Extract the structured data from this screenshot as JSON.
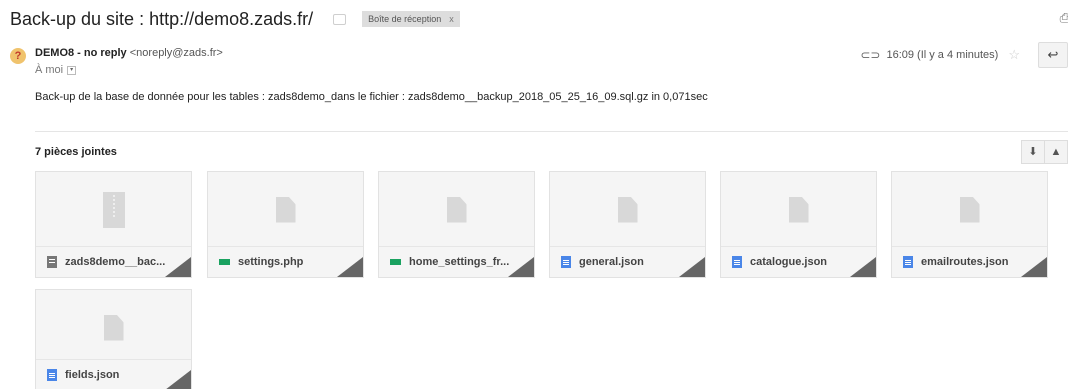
{
  "email": {
    "subject": "Back-up du site : http://demo8.zads.fr/",
    "label_chip": "Boîte de réception",
    "label_remove": "x",
    "sender_name": "DEMO8 - no reply",
    "sender_email": "<noreply@zads.fr>",
    "to_line": "À moi",
    "time": "16:09 (Il y a 4 minutes)",
    "body": "Back-up de la base de donnée pour les tables : zads8demo_dans le fichier : zads8demo__backup_2018_05_25_16_09.sql.gz in 0,071sec"
  },
  "attachments": {
    "header": "7 pièces jointes",
    "items": [
      {
        "name": "zads8demo__bac...",
        "type": "archive"
      },
      {
        "name": "settings.php",
        "type": "code"
      },
      {
        "name": "home_settings_fr...",
        "type": "code"
      },
      {
        "name": "general.json",
        "type": "doc"
      },
      {
        "name": "catalogue.json",
        "type": "doc"
      },
      {
        "name": "emailroutes.json",
        "type": "doc"
      },
      {
        "name": "fields.json",
        "type": "doc"
      }
    ]
  },
  "icons": {
    "avatar": "?",
    "reply": "↩",
    "download_all": "⬇",
    "drive": "drive-icon",
    "colors": {
      "avatar_bg": "#f0c36d",
      "code_icon": "#1aa260",
      "doc_icon": "#4a86e8"
    }
  }
}
